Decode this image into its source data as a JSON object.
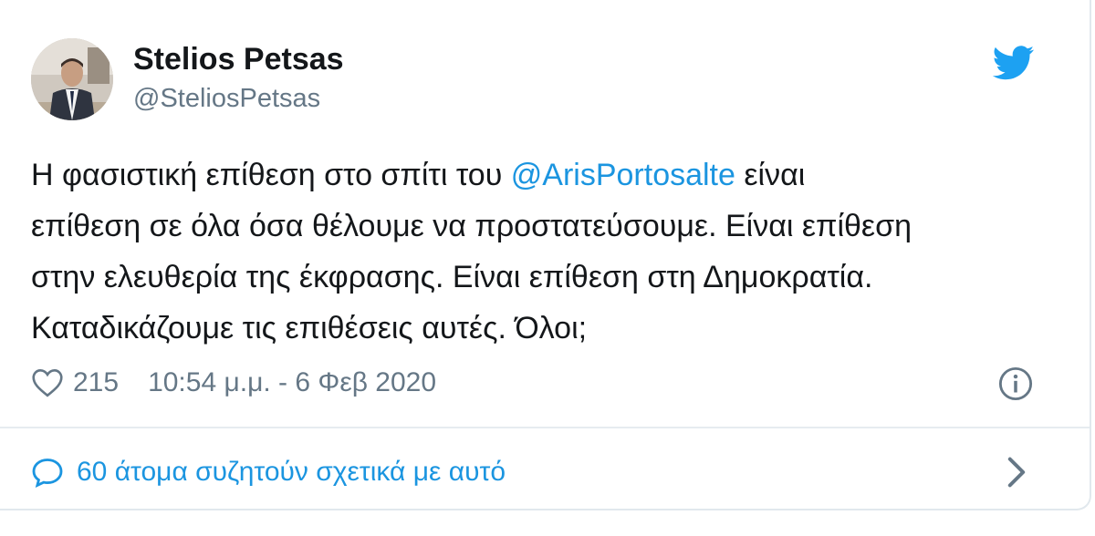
{
  "author": {
    "name": "Stelios Petsas",
    "handle": "@SteliosPetsas"
  },
  "tweet": {
    "line1_before": "Η φασιστική επίθεση στο σπίτι του ",
    "mention": "@ArisPortosalte",
    "line1_after": " είναι",
    "line2": "επίθεση σε όλα όσα θέλουμε να προστατεύσουμε. Είναι επίθεση",
    "line3": "στην ελευθερία της έκφρασης. Είναι επίθεση στη Δημοκρατία.",
    "line4": "Καταδικάζουμε τις επιθέσεις αυτές. Όλοι;"
  },
  "meta": {
    "likes": "215",
    "timestamp": "10:54 μ.μ. - 6 Φεβ 2020"
  },
  "conversation": {
    "label": "60 άτομα συζητούν σχετικά με αυτό"
  },
  "icons": {
    "brand": "twitter-bird-icon",
    "like": "heart-icon",
    "info": "info-icon",
    "reply": "speech-bubble-icon",
    "chevron": "chevron-right-icon"
  },
  "colors": {
    "brand_blue": "#1da1f2",
    "link_blue": "#1b95e0",
    "text": "#14171a",
    "secondary": "#657786",
    "border": "#e1e8ed"
  }
}
